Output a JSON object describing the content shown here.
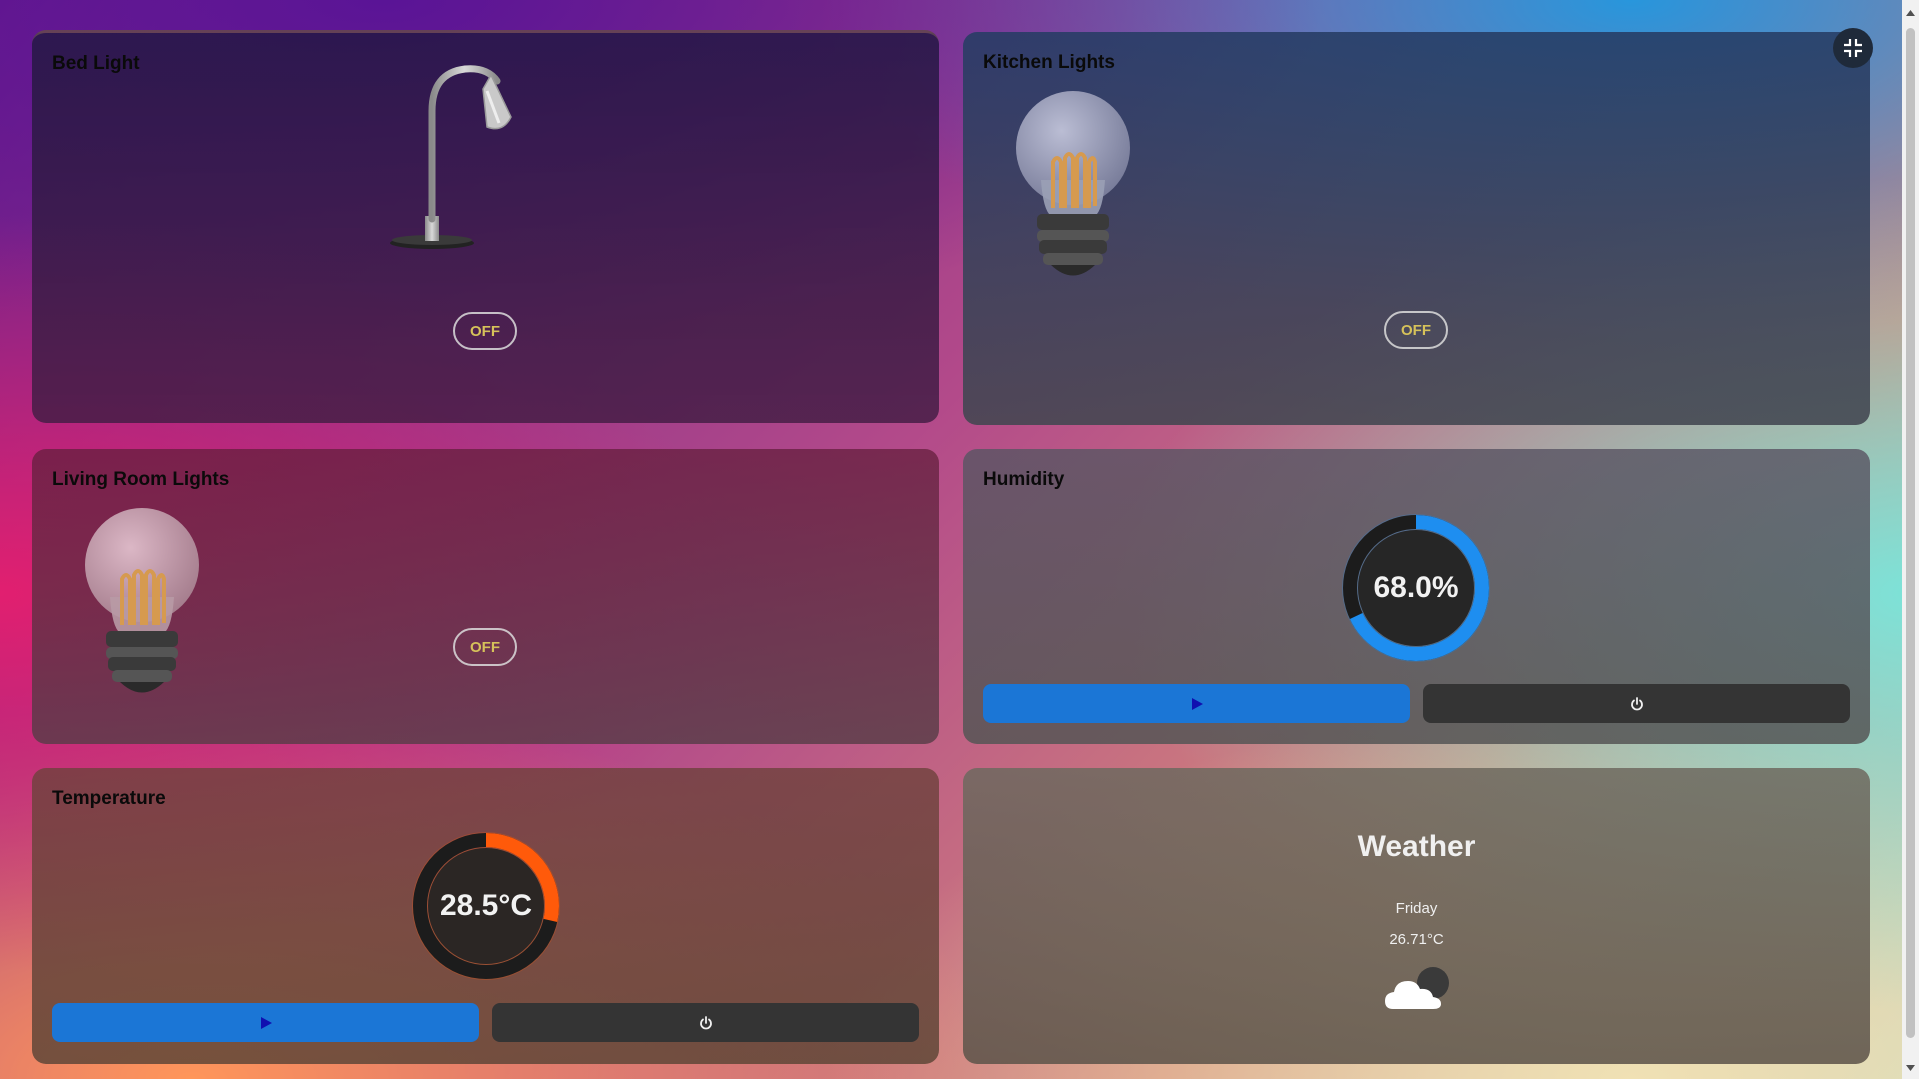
{
  "cards": {
    "bed_light": {
      "title": "Bed Light",
      "state": "OFF"
    },
    "kitchen_lights": {
      "title": "Kitchen Lights",
      "state": "OFF"
    },
    "living_room_lights": {
      "title": "Living Room Lights",
      "state": "OFF"
    },
    "humidity": {
      "title": "Humidity",
      "value_text": "68.0%",
      "level": 0.68,
      "accent": "#1e8ef0"
    },
    "temperature": {
      "title": "Temperature",
      "value_text": "28.5°C",
      "level": 0.285,
      "accent": "#ff5a0a"
    },
    "weather": {
      "title": "Weather",
      "day": "Friday",
      "temp": "26.71°C",
      "icon": "partly-cloudy-night-icon"
    }
  },
  "controls": {
    "play_icon": "play-icon",
    "power_icon": "power-icon",
    "play_color": "#1b76d6",
    "power_color": "#343434"
  },
  "toolbar": {
    "exit_fullscreen_icon": "exit-fullscreen-icon"
  }
}
